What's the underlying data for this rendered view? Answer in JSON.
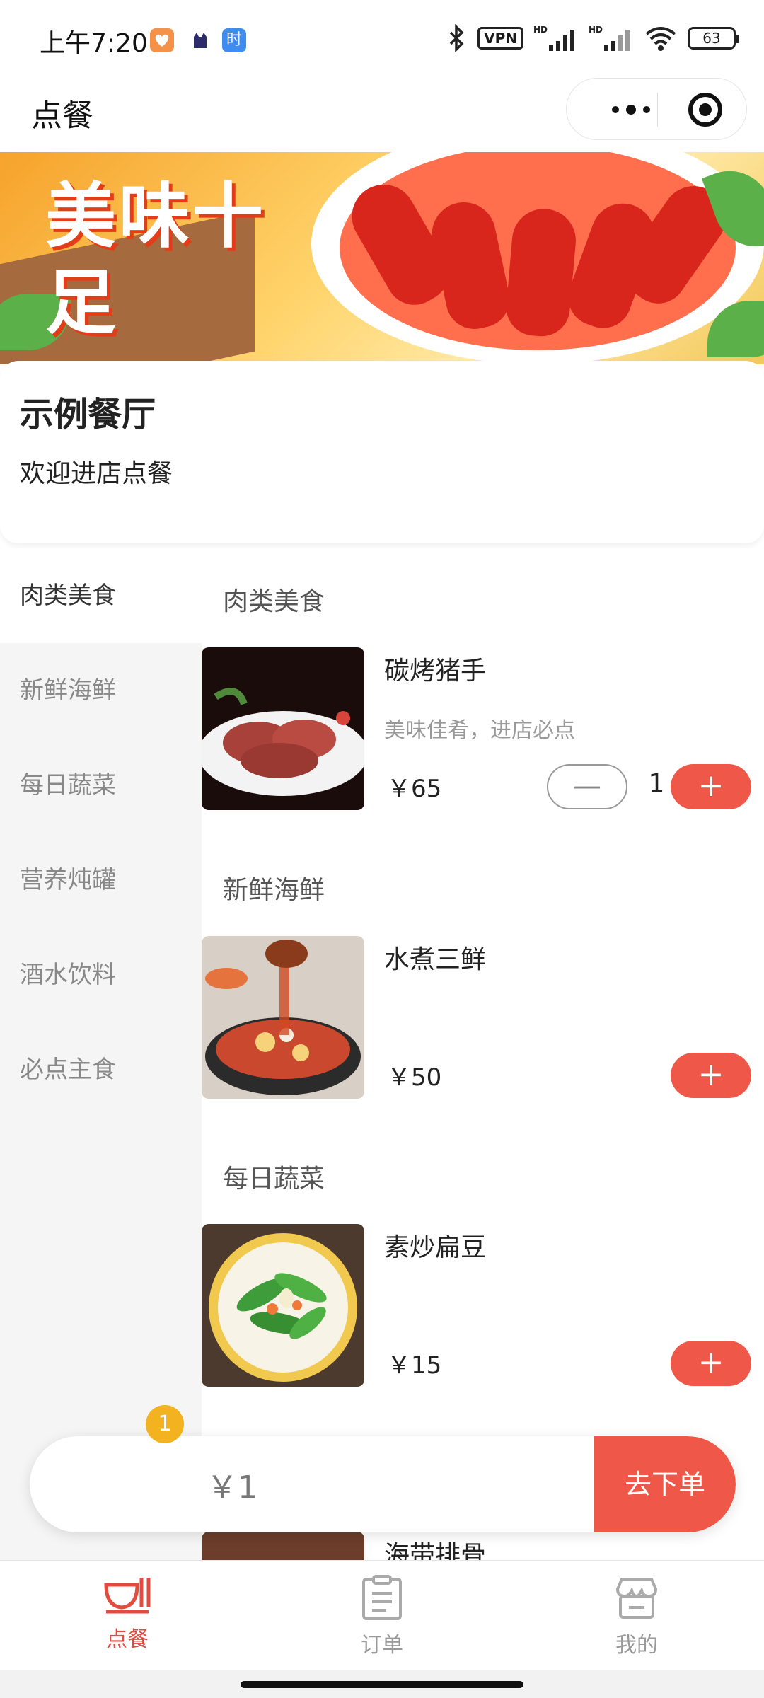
{
  "status_bar": {
    "time": "上午7:20",
    "vpn": "VPN",
    "battery": "63",
    "colors": {
      "health_app": "#f5924a",
      "cat_app": "#2d2d6b",
      "time_app": "#3f8cf0"
    }
  },
  "nav": {
    "title": "点餐"
  },
  "banner": {
    "text": "美味十足"
  },
  "shop": {
    "name": "示例餐厅",
    "description": "欢迎进店点餐"
  },
  "categories": [
    {
      "label": "肉类美食",
      "active": true
    },
    {
      "label": "新鲜海鲜",
      "active": false
    },
    {
      "label": "每日蔬菜",
      "active": false
    },
    {
      "label": "营养炖罐",
      "active": false
    },
    {
      "label": "酒水饮料",
      "active": false
    },
    {
      "label": "必点主食",
      "active": false
    }
  ],
  "sections": [
    {
      "title": "肉类美食",
      "dishes": [
        {
          "name": "碳烤猪手",
          "description": "美味佳肴，进店必点",
          "price": "￥65",
          "quantity": "1"
        }
      ]
    },
    {
      "title": "新鲜海鲜",
      "dishes": [
        {
          "name": "水煮三鲜",
          "description": "",
          "price": "￥50"
        }
      ]
    },
    {
      "title": "每日蔬菜",
      "dishes": [
        {
          "name": "素炒扁豆",
          "description": "",
          "price": "￥15"
        },
        {
          "name": "海带排骨",
          "description": "",
          "price": ""
        }
      ]
    }
  ],
  "buttons": {
    "plus": "+",
    "minus": "—"
  },
  "cart": {
    "badge_count": "1",
    "total": "￥1",
    "checkout_label": "去下单"
  },
  "tabs": [
    {
      "label": "点餐",
      "icon": "bowl-icon",
      "active": true
    },
    {
      "label": "订单",
      "icon": "clipboard-icon",
      "active": false
    },
    {
      "label": "我的",
      "icon": "store-icon",
      "active": false
    }
  ],
  "colors": {
    "accent": "#ef5848",
    "badge": "#f3b21f",
    "active_tab": "#e34b3e"
  }
}
